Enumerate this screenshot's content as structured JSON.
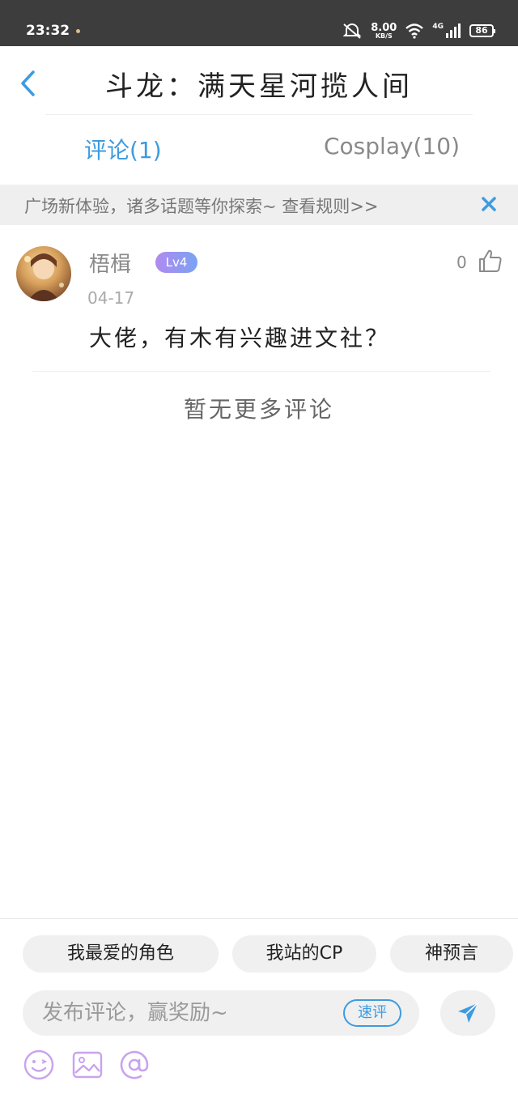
{
  "status_bar": {
    "time": "23:32",
    "net_speed_value": "8.00",
    "net_speed_unit": "KB/S",
    "network": "4G",
    "battery": "86"
  },
  "header": {
    "title": "斗龙：满天星河揽人间"
  },
  "tabs": [
    {
      "label": "评论(1)",
      "active": true
    },
    {
      "label": "Cosplay(10)",
      "active": false
    }
  ],
  "notice": {
    "text": "广场新体验，诸多话题等你探索~ 查看规则>>"
  },
  "comment": {
    "username": "梧楫",
    "level": "Lv4",
    "date": "04-17",
    "likes": "0",
    "content": "大佬，有木有兴趣进文社？"
  },
  "no_more": "暂无更多评论",
  "composer": {
    "chips": [
      "我最爱的角色",
      "我站的CP",
      "神预言"
    ],
    "placeholder": "发布评论，赢奖励~",
    "quick_label": "速评"
  },
  "colors": {
    "accent": "#3d9be0",
    "level_badge": "#9b8cf0",
    "status_bar": "#3d3d3d"
  }
}
